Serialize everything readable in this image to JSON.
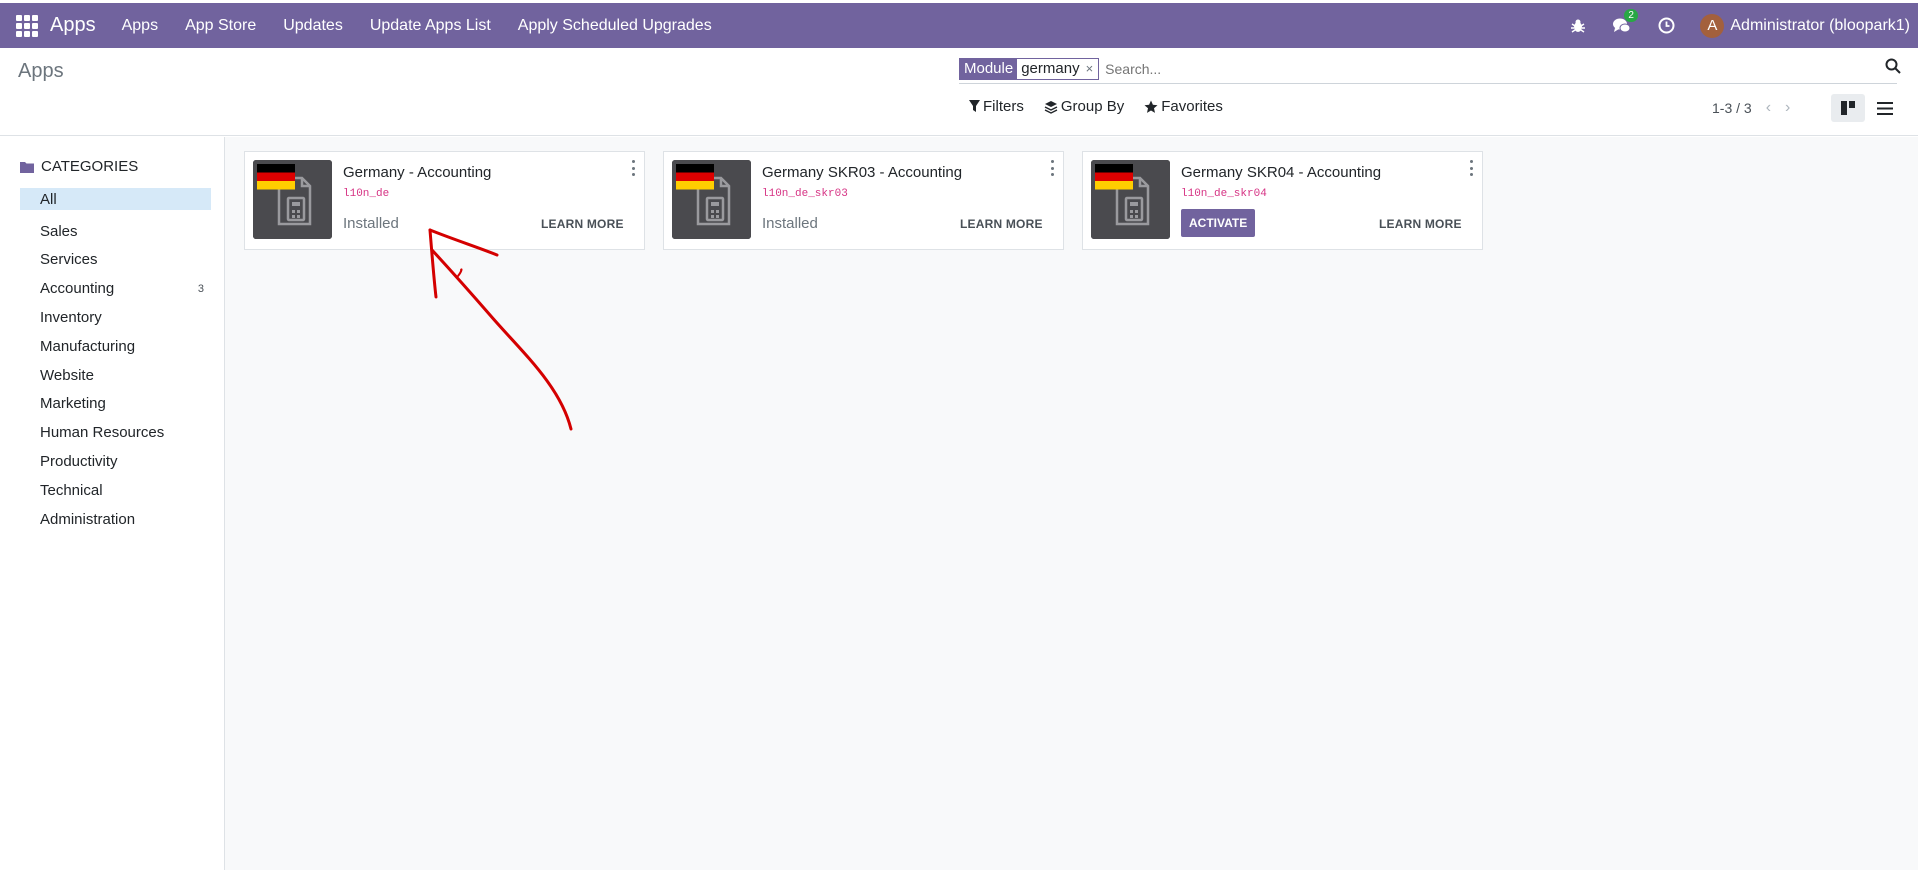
{
  "navbar": {
    "brand": "Apps",
    "menu": [
      "Apps",
      "App Store",
      "Updates",
      "Update Apps List",
      "Apply Scheduled Upgrades"
    ],
    "messages_badge": "2",
    "user_initial": "A",
    "user_name": "Administrator (bloopark1)",
    "bg_color": "#71639e"
  },
  "control_panel": {
    "breadcrumb": "Apps",
    "facet": {
      "label": "Module",
      "value": "germany",
      "remove": "×"
    },
    "search_placeholder": "Search...",
    "filters": [
      "Filters",
      "Group By",
      "Favorites"
    ],
    "pager": "1-3 / 3"
  },
  "sidebar": {
    "header": "CATEGORIES",
    "items": [
      {
        "label": "All",
        "count": ""
      },
      {
        "label": "Sales",
        "count": ""
      },
      {
        "label": "Services",
        "count": ""
      },
      {
        "label": "Accounting",
        "count": "3"
      },
      {
        "label": "Inventory",
        "count": ""
      },
      {
        "label": "Manufacturing",
        "count": ""
      },
      {
        "label": "Website",
        "count": ""
      },
      {
        "label": "Marketing",
        "count": ""
      },
      {
        "label": "Human Resources",
        "count": ""
      },
      {
        "label": "Productivity",
        "count": ""
      },
      {
        "label": "Technical",
        "count": ""
      },
      {
        "label": "Administration",
        "count": ""
      }
    ]
  },
  "modules": [
    {
      "title": "Germany - Accounting",
      "technical": "l10n_de",
      "status": "Installed",
      "action": "",
      "learn_more": "LEARN MORE"
    },
    {
      "title": "Germany SKR03 - Accounting",
      "technical": "l10n_de_skr03",
      "status": "Installed",
      "action": "",
      "learn_more": "LEARN MORE"
    },
    {
      "title": "Germany SKR04 - Accounting",
      "technical": "l10n_de_skr04",
      "status": "",
      "action": "ACTIVATE",
      "learn_more": "LEARN MORE"
    }
  ]
}
